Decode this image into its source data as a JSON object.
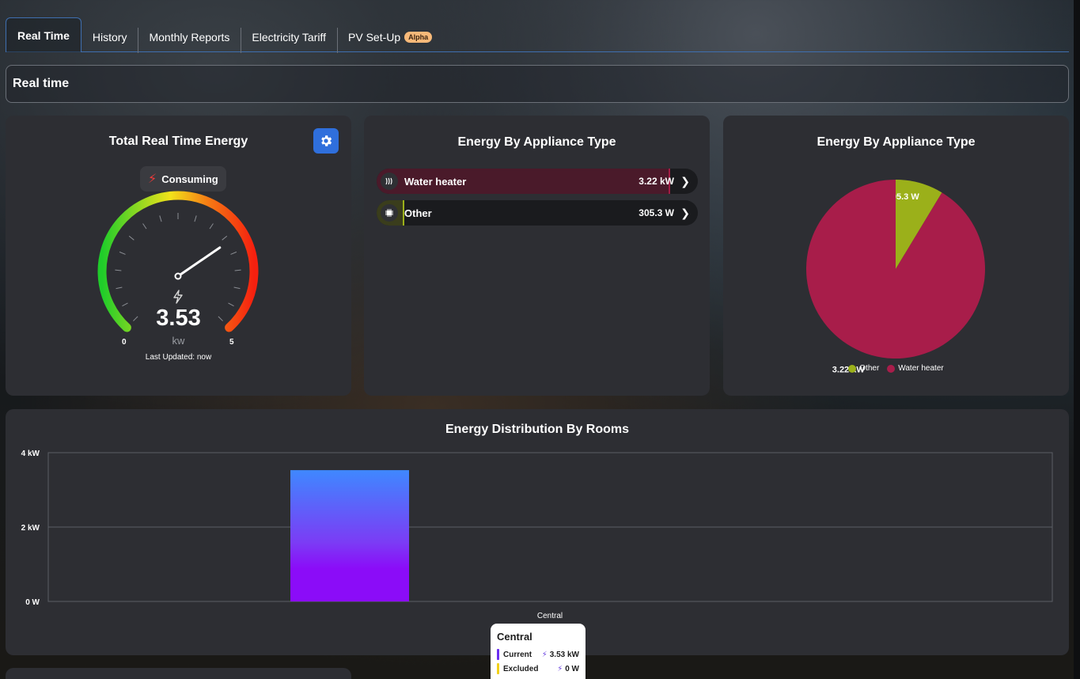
{
  "tabs": [
    {
      "label": "Real Time",
      "active": true
    },
    {
      "label": "History"
    },
    {
      "label": "Monthly Reports"
    },
    {
      "label": "Electricity Tariff"
    },
    {
      "label": "PV Set-Up",
      "badge": "Alpha"
    }
  ],
  "header": {
    "title": "Real time"
  },
  "gauge_card": {
    "title": "Total Real Time Energy",
    "status": "Consuming",
    "value": "3.53",
    "value_number": 3.53,
    "unit": "kw",
    "min": "0",
    "max": "5",
    "last_updated": "Last Updated: now",
    "settings_icon": "gear-icon"
  },
  "appliance_list": {
    "title": "Energy By Appliance Type",
    "items": [
      {
        "name": "Water heater",
        "value": "3.22 kW",
        "icon": "heat-waves-icon",
        "color": "#a21c44",
        "share": 0.913
      },
      {
        "name": "Other",
        "value": "305.3 W",
        "icon": "chip-icon",
        "color": "#9bb01a",
        "share": 0.087
      }
    ]
  },
  "appliance_pie": {
    "title": "Energy By Appliance Type",
    "legend": [
      {
        "name": "Other",
        "color": "#9bb01a"
      },
      {
        "name": "Water heater",
        "color": "#a81d4a"
      }
    ]
  },
  "rooms_chart": {
    "title": "Energy Distribution By Rooms",
    "tooltip": {
      "title": "Central",
      "rows": [
        {
          "label": "Current",
          "value": "3.53 kW",
          "color": "#6b2ff0"
        },
        {
          "label": "Excluded",
          "value": "0 W",
          "color": "#f2d11a"
        }
      ]
    }
  },
  "chart_data": [
    {
      "type": "pie",
      "title": "Energy By Appliance Type",
      "categories": [
        "Other",
        "Water heater"
      ],
      "values": [
        305.3,
        3220
      ],
      "labels": [
        "305.3 W",
        "3.22 kW"
      ],
      "colors": [
        "#9bb01a",
        "#a81d4a"
      ],
      "legend": "bottom"
    },
    {
      "type": "bar",
      "title": "Energy Distribution By Rooms",
      "categories": [
        "Central"
      ],
      "values": [
        3.53
      ],
      "yticks": [
        "0 W",
        "2 kW",
        "4 kW"
      ],
      "ylim": [
        0,
        4
      ],
      "grid": true
    }
  ]
}
